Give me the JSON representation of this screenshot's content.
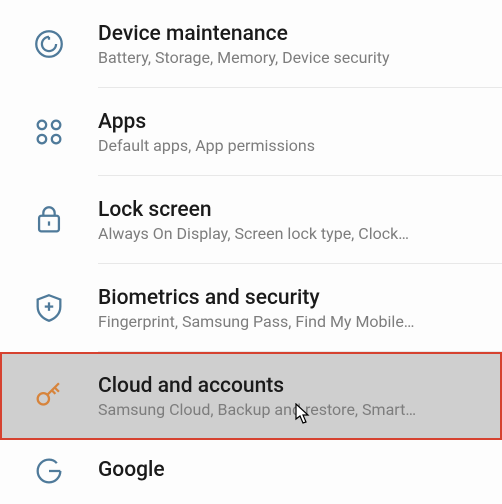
{
  "settings": {
    "items": [
      {
        "title": "Device maintenance",
        "subtitle": "Battery, Storage, Memory, Device security"
      },
      {
        "title": "Apps",
        "subtitle": "Default apps, App permissions"
      },
      {
        "title": "Lock screen",
        "subtitle": "Always On Display, Screen lock type, Clock…"
      },
      {
        "title": "Biometrics and security",
        "subtitle": "Fingerprint, Samsung Pass, Find My Mobile…"
      },
      {
        "title": "Cloud and accounts",
        "subtitle": "Samsung Cloud, Backup and restore, Smart…"
      },
      {
        "title": "Google",
        "subtitle": ""
      }
    ]
  }
}
